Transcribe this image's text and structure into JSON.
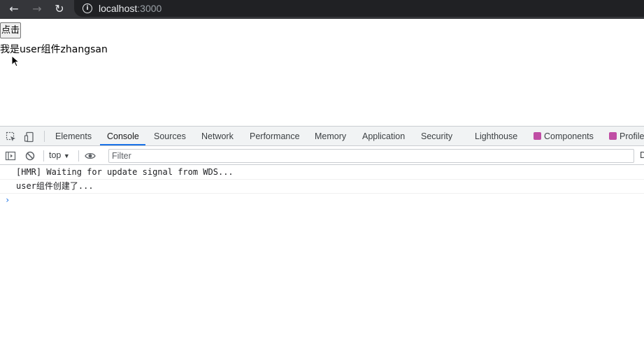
{
  "browser": {
    "back_icon": "←",
    "forward_icon": "→",
    "reload_icon": "↻",
    "info_icon": "i",
    "url_host": "localhost",
    "url_port": ":3000"
  },
  "page": {
    "button_label": "点击",
    "text": "我是user组件zhangsan"
  },
  "devtools": {
    "tabs": [
      {
        "label": "Elements"
      },
      {
        "label": "Console"
      },
      {
        "label": "Sources"
      },
      {
        "label": "Network"
      },
      {
        "label": "Performance"
      },
      {
        "label": "Memory"
      },
      {
        "label": "Application"
      },
      {
        "label": "Security"
      },
      {
        "label": "Lighthouse"
      },
      {
        "label": "Components"
      },
      {
        "label": "Profiler"
      }
    ],
    "active_tab": "Console",
    "context": "top",
    "context_arrow": "▼",
    "filter_placeholder": "Filter",
    "edge_char": "D",
    "console_lines": [
      "[HMR] Waiting for update signal from WDS...",
      "user组件创建了..."
    ],
    "prompt_symbol": "›",
    "accent_color": "#1a73e8",
    "react_icon_color": "#c04ea5"
  }
}
